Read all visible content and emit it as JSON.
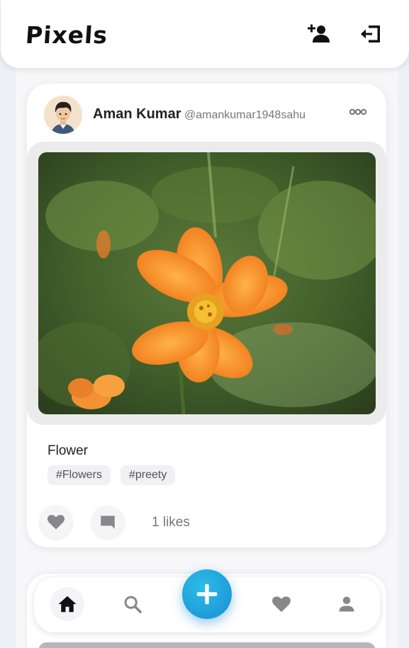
{
  "header": {
    "title": "Pixels",
    "add_friend_icon": "person-add-icon",
    "logout_icon": "logout-icon"
  },
  "post": {
    "author_name": "Aman Kumar",
    "author_handle": "@amankumar1948sahu",
    "caption": "Flower",
    "tags": [
      "#Flowers",
      "#preety"
    ],
    "likes_text": "1 likes",
    "image_subject": "orange-cosmos-flower"
  },
  "nav": {
    "items": [
      "home-icon",
      "search-icon",
      "add-icon",
      "heart-icon",
      "profile-icon"
    ],
    "active": "home-icon"
  },
  "colors": {
    "accent": "#1f9fdc",
    "icon_gray": "#888888",
    "dark": "#111111"
  }
}
